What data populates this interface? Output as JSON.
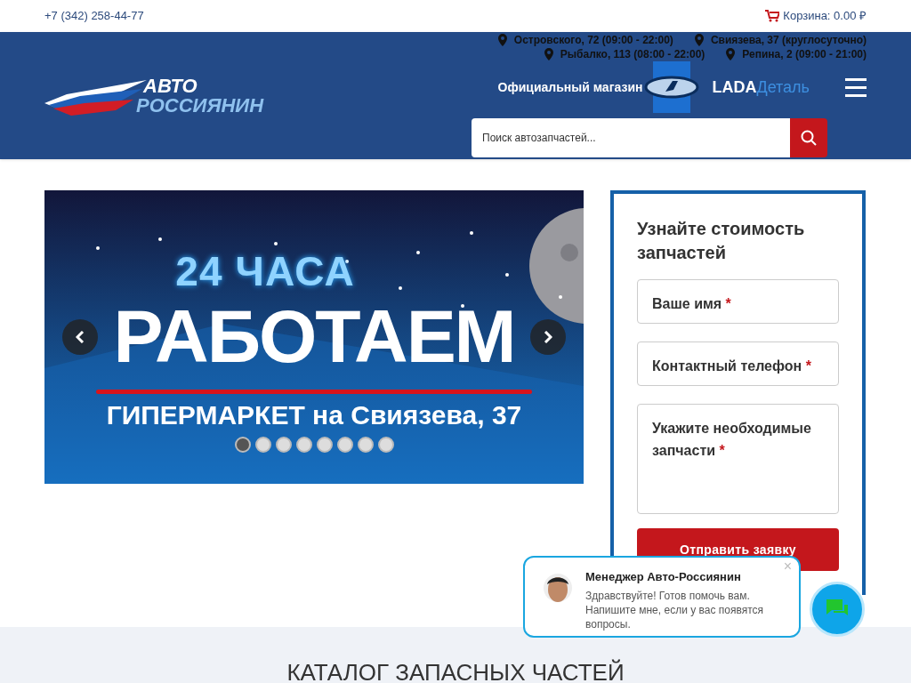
{
  "topbar": {
    "phone": "+7 (342) 258-44-77",
    "cart": "Корзина: 0.00 ₽"
  },
  "header": {
    "logo": {
      "line1": "АВТО",
      "line2": "РОССИЯНИН"
    },
    "addresses": [
      [
        "Островского, 72 (09:00 - 22:00)",
        "Свиязева, 37 (круглосуточно)"
      ],
      [
        "Рыбалко, 113 (08:00 - 22:00)",
        "Репина, 2 (09:00 - 21:00)"
      ]
    ],
    "official": "Официальный магазин",
    "brand_main": "LADA",
    "brand_sub": "Деталь",
    "search": {
      "placeholder": "Поиск автозапчастей..."
    }
  },
  "slider": {
    "line1": "24 ЧАСА",
    "line2": "РАБОТАЕМ",
    "line3": "ГИПЕРМАРКЕТ на Свиязева, 37",
    "dots": [
      {
        "selected": true
      },
      {
        "selected": false
      },
      {
        "selected": false
      },
      {
        "selected": false
      },
      {
        "selected": false
      },
      {
        "selected": false
      },
      {
        "selected": false
      },
      {
        "selected": false
      }
    ]
  },
  "form": {
    "title": "Узнайте стоимость запчастей",
    "fields": [
      {
        "kind": "line",
        "label": "Ваше имя",
        "mark": "*"
      },
      {
        "kind": "line",
        "label": "Контактный телефон",
        "mark": "*"
      },
      {
        "kind": "area",
        "label": "Укажите необходимые запчасти",
        "mark": "*"
      }
    ],
    "submit": "Отправить заявку"
  },
  "chat": {
    "name": "Менеджер Авто-Россиянин",
    "message": "Здравствуйте! Готов помочь вам. Напишите мне, если у вас появятся вопросы.",
    "close": "×"
  },
  "catalog": {
    "title": "КАТАЛОГ ЗАПАСНЫХ ЧАСТЕЙ"
  }
}
